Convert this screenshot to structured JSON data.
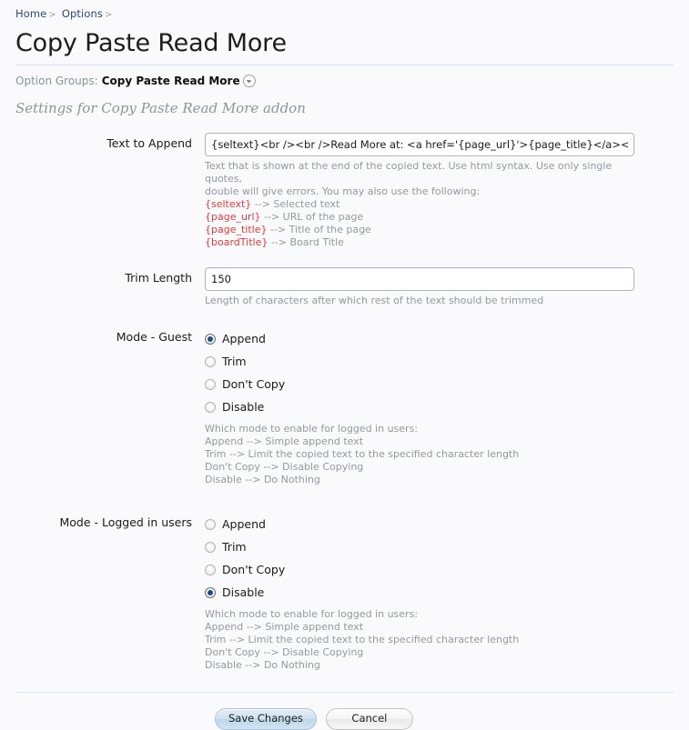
{
  "breadcrumb": {
    "items": [
      {
        "label": "Home",
        "sep": ">"
      },
      {
        "label": "Options",
        "sep": ">"
      }
    ]
  },
  "page": {
    "title": "Copy Paste Read More",
    "subtitle": "Settings for Copy Paste Read More addon"
  },
  "option_groups": {
    "label": "Option Groups:",
    "value": "Copy Paste Read More",
    "dropdown_icon": "chevron-down-icon"
  },
  "form": {
    "text_to_append": {
      "label": "Text to Append",
      "value": "{seltext}<br /><br />Read More at: <a href='{page_url}'>{page_title}</a><br />Copyright",
      "placeholder": "",
      "hint_line1": "Text that is shown at the end of the copied text. Use html syntax. Use only single quotes,",
      "hint_line2": "double will give errors. You may also use the following:",
      "tokens": [
        {
          "token": "{seltext}",
          "desc": "--> Selected text"
        },
        {
          "token": "{page_url}",
          "desc": "--> URL of the page"
        },
        {
          "token": "{page_title}",
          "desc": "--> Title of the page"
        },
        {
          "token": "{boardTitle}",
          "desc": "--> Board Title"
        }
      ]
    },
    "trim_length": {
      "label": "Trim Length",
      "value": "150",
      "placeholder": "",
      "hint": "Length of characters after which rest of the text should be trimmed"
    },
    "mode_guest": {
      "label": "Mode - Guest",
      "options": [
        {
          "label": "Append",
          "checked": true
        },
        {
          "label": "Trim",
          "checked": false
        },
        {
          "label": "Don't Copy",
          "checked": false
        },
        {
          "label": "Disable",
          "checked": false
        }
      ],
      "hint_lines": [
        "Which mode to enable for logged in users:",
        "Append --> Simple append text",
        "Trim --> Limit the copied text to the specified character length",
        "Don't Copy --> Disable Copying",
        "Disable --> Do Nothing"
      ]
    },
    "mode_logged_in": {
      "label": "Mode - Logged in users",
      "options": [
        {
          "label": "Append",
          "checked": false
        },
        {
          "label": "Trim",
          "checked": false
        },
        {
          "label": "Don't Copy",
          "checked": false
        },
        {
          "label": "Disable",
          "checked": true
        }
      ],
      "hint_lines": [
        "Which mode to enable for logged in users:",
        "Append --> Simple append text",
        "Trim --> Limit the copied text to the specified character length",
        "Don't Copy --> Disable Copying",
        "Disable --> Do Nothing"
      ]
    }
  },
  "footer": {
    "save_label": "Save Changes",
    "cancel_label": "Cancel"
  },
  "colors": {
    "background": "#fafafd",
    "rule": "#d6e5f2",
    "link": "#2b4a76",
    "hint": "#9498a0",
    "token_red": "#e23c3c",
    "radio_dot": "#1a4f86"
  }
}
